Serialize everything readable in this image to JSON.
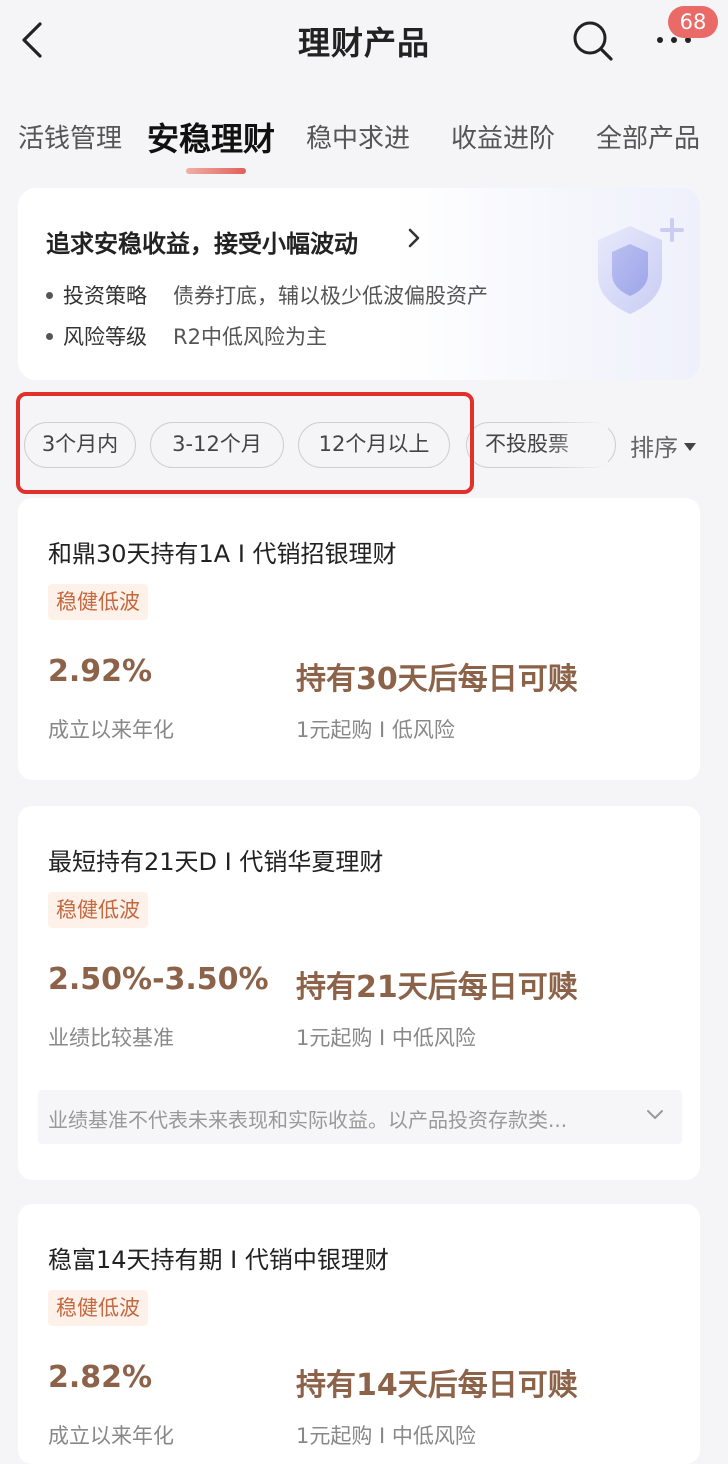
{
  "header": {
    "title": "理财产品",
    "badge_count": "68"
  },
  "tabs": [
    {
      "label": "活钱管理"
    },
    {
      "label": "安稳理财"
    },
    {
      "label": "稳中求进"
    },
    {
      "label": "收益进阶"
    },
    {
      "label": "全部产品"
    }
  ],
  "intro": {
    "title": "追求安稳收益，接受小幅波动",
    "rows": [
      {
        "label": "投资策略",
        "value": "债券打底，辅以极少低波偏股资产"
      },
      {
        "label": "风险等级",
        "value": "R2中低风险为主"
      }
    ]
  },
  "filters": {
    "chips": [
      "3个月内",
      "3-12个月",
      "12个月以上",
      "不投股票"
    ],
    "sort_label": "排序"
  },
  "products": [
    {
      "name": "和鼎30天持有1A I 代销招银理财",
      "tag": "稳健低波",
      "rate": "2.92%",
      "rate_label": "成立以来年化",
      "redeem": "持有30天后每日可赎",
      "min_info": "1元起购 I 低风险"
    },
    {
      "name": "最短持有21天D I 代销华夏理财",
      "tag": "稳健低波",
      "rate": "2.50%-3.50%",
      "rate_label": "业绩比较基准",
      "redeem": "持有21天后每日可赎",
      "min_info": "1元起购 I 中低风险",
      "disclaimer": "业绩基准不代表未来表现和实际收益。以产品投资存款类..."
    },
    {
      "name": "稳富14天持有期 I 代销中银理财",
      "tag": "稳健低波",
      "rate": "2.82%",
      "rate_label": "成立以来年化",
      "redeem": "持有14天后每日可赎",
      "min_info": "1元起购 I 中低风险"
    }
  ],
  "colors": {
    "accent": "#e0605a",
    "highlight_box": "#e0312c",
    "rate": "#8c6249",
    "tag_text": "#c4693f",
    "tag_bg": "#fdf1ea"
  },
  "icons": {
    "back": "chevron-left-icon",
    "search": "search-icon",
    "more": "more-icon",
    "intro_arrow": "chevron-right-icon",
    "shield": "shield-icon",
    "sort": "triangle-down-icon"
  }
}
